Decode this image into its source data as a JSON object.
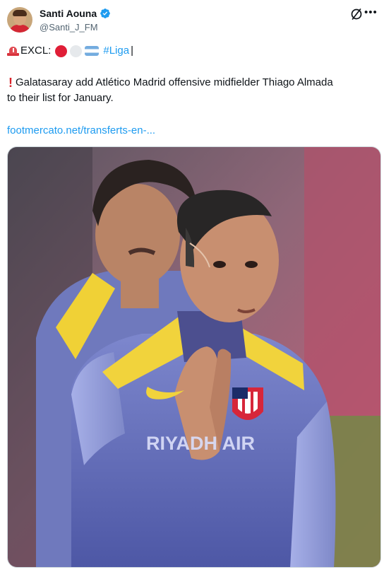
{
  "author": {
    "name": "Santi Aouna",
    "handle": "@Santi_J_FM",
    "verified_icon": "verified-badge-icon",
    "accent": "#1d9bf0"
  },
  "header_icons": [
    "grok-icon",
    "more-icon"
  ],
  "tweet": {
    "line1_prefix": "EXCL:",
    "line1_flags": [
      "red-circle",
      "white-circle",
      "argentina-flag"
    ],
    "hashtag": "#Liga",
    "line1_suffix": "|",
    "line2": "Galatasaray add Atlético Madrid offensive midfielder Thiago Almada",
    "line3": "to their list for January.",
    "link": "footmercato.net/transferts-en-...",
    "media_text": "RIYADH AIR"
  },
  "colors": {
    "link": "#1d9bf0",
    "text": "#0f1419",
    "secondary": "#536471",
    "jersey": "#6f79bd",
    "jersey_accent": "#f1d33c"
  }
}
